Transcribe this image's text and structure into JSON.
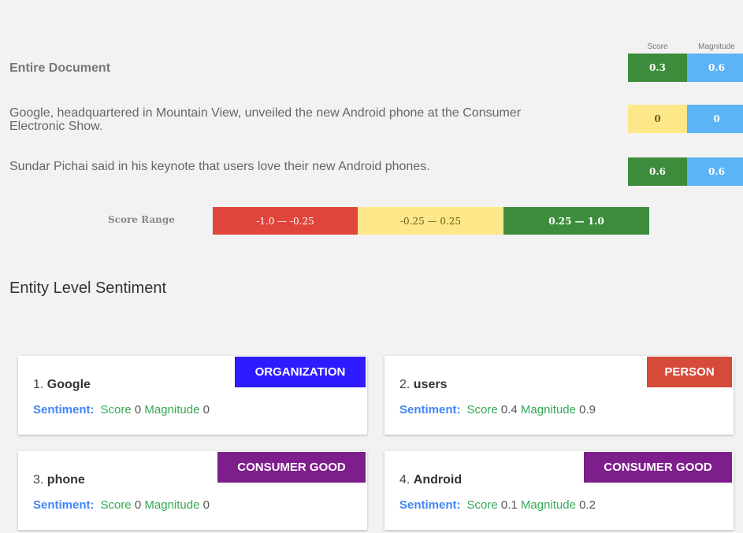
{
  "columns": {
    "score": "Score",
    "magnitude": "Magnitude"
  },
  "colors": {
    "green": "#3c8c3c",
    "yellow": "#fde889",
    "red": "#e0443a",
    "blue": "#5cb3f5",
    "org": "#2f1bff",
    "person": "#d64a3a",
    "consumer": "#7e1e8c"
  },
  "document": {
    "title": "Entire Document",
    "score": "0.3",
    "magnitude": "0.6"
  },
  "sentences": [
    {
      "text": "Google, headquartered in Mountain View, unveiled the new Android phone at the Consumer Electronic Show.",
      "score": "0",
      "magnitude": "0"
    },
    {
      "text": "Sundar Pichai said in his keynote that users love their new Android phones.",
      "score": "0.6",
      "magnitude": "0.6"
    }
  ],
  "score_range": {
    "label": "Score Range",
    "ranges": [
      "-1.0 — -0.25",
      "-0.25 — 0.25",
      "0.25 — 1.0"
    ]
  },
  "entity_section": {
    "title": "Entity Level Sentiment"
  },
  "entities": [
    {
      "index": "1.",
      "name": "Google",
      "type": "ORGANIZATION",
      "sentiment_label": "Sentiment:",
      "score_label": "Score",
      "score": "0",
      "magnitude_label": "Magnitude",
      "magnitude": "0"
    },
    {
      "index": "2.",
      "name": "users",
      "type": "PERSON",
      "sentiment_label": "Sentiment:",
      "score_label": "Score",
      "score": "0.4",
      "magnitude_label": "Magnitude",
      "magnitude": "0.9"
    },
    {
      "index": "3.",
      "name": "phone",
      "type": "CONSUMER GOOD",
      "sentiment_label": "Sentiment:",
      "score_label": "Score",
      "score": "0",
      "magnitude_label": "Magnitude",
      "magnitude": "0"
    },
    {
      "index": "4.",
      "name": "Android",
      "type": "CONSUMER GOOD",
      "sentiment_label": "Sentiment:",
      "score_label": "Score",
      "score": "0.1",
      "magnitude_label": "Magnitude",
      "magnitude": "0.2"
    }
  ]
}
